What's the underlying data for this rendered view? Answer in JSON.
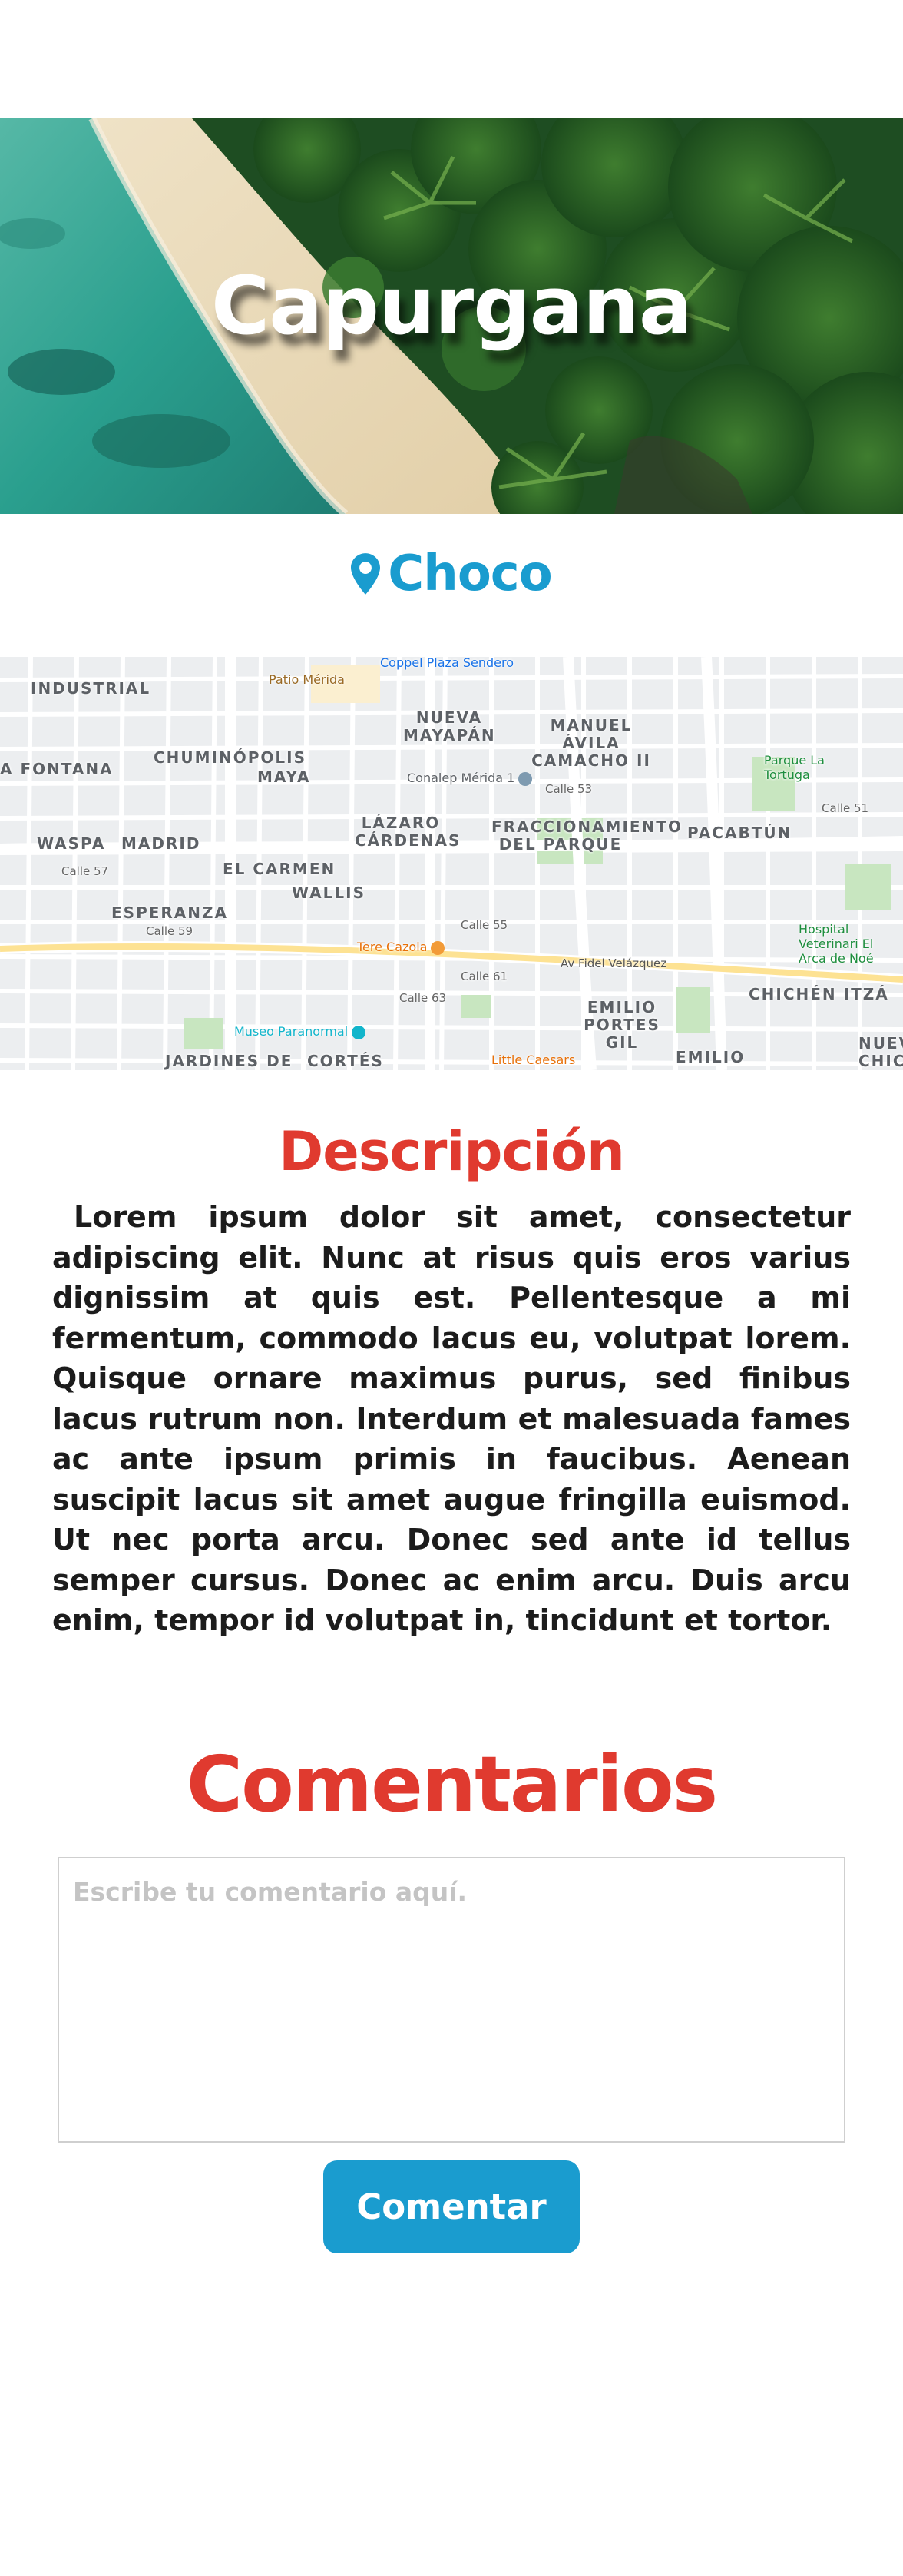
{
  "hero": {
    "title": "Capurgana"
  },
  "location": {
    "icon": "location-pin-icon",
    "name": "Choco",
    "color": "#1a9ccf"
  },
  "map": {
    "neighborhoods": [
      "INDUSTRIAL",
      "NUEVA MAYAPÁN",
      "MANUEL ÁVILA CAMACHO II",
      "CHUMINÓPOLIS",
      "A FONTANA",
      "MAYA",
      "LÁZARO CÁRDENAS",
      "FRACCIONAMIENTO DEL PARQUE",
      "PACABTÚN",
      "WASPA",
      "MADRID",
      "EL CARMEN",
      "WALLIS",
      "ESPERANZA",
      "CHICHÉN ITZÁ",
      "EMILIO PORTES GIL",
      "JARDINES DE",
      "CORTÉS",
      "EMILIO",
      "NUEV CHICH"
    ],
    "places": [
      "Patio Mérida",
      "Coppel Plaza Sendero",
      "Conalep Mérida 1",
      "Parque La Tortuga",
      "Hospital Veterinari El Arca de Noé",
      "Tere Cazola",
      "Museo Paranormal",
      "Little Caesars"
    ],
    "streets": [
      "Calle 59",
      "Calle 51",
      "Calle 57",
      "Calle 61",
      "Av Fidel Velázquez",
      "Calle 63",
      "Calle 53",
      "Calle 55"
    ]
  },
  "description": {
    "title": "Descripción",
    "text": "Lorem ipsum dolor sit amet, consectetur adipiscing elit. Nunc at risus quis eros varius dignissim at quis est. Pellentesque a mi fermentum, commodo lacus eu, volutpat lorem. Quisque ornare maximus purus, sed finibus lacus rutrum non. Interdum et malesuada fames ac ante ipsum primis in faucibus. Aenean suscipit lacus sit amet augue fringilla euismod. Ut nec porta arcu. Donec sed ante id tellus semper cursus. Donec ac enim arcu. Duis arcu enim, tempor id volutpat in, tincidunt et tortor."
  },
  "comments": {
    "title": "Comentarios",
    "input_value": "",
    "placeholder": "Escribe tu comentario aquí.",
    "button_label": "Comentar"
  },
  "colors": {
    "accent_red": "#e03a2f",
    "accent_blue": "#1a9ccf"
  }
}
